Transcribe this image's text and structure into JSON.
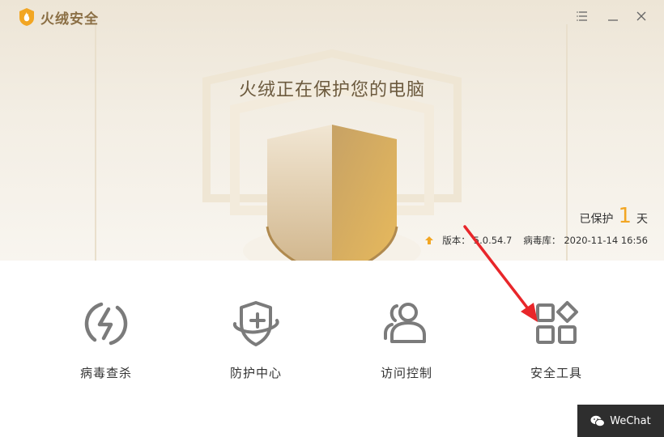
{
  "app": {
    "title": "火绒安全"
  },
  "window_controls": {
    "menu_icon": "menu-icon",
    "minimize_icon": "minimize-icon",
    "close_icon": "close-icon"
  },
  "status": {
    "headline": "火绒正在保护您的电脑",
    "protected_prefix": "已保护",
    "protected_days": "1",
    "protected_suffix": "天"
  },
  "version_info": {
    "version_label": "版本：",
    "version_value": "5.0.54.7",
    "db_label": "病毒库：",
    "db_value": "2020-11-14 16:56"
  },
  "tools": [
    {
      "label": "病毒查杀",
      "icon": "lightning-circle-icon"
    },
    {
      "label": "防护中心",
      "icon": "shield-plus-icon"
    },
    {
      "label": "访问控制",
      "icon": "users-icon"
    },
    {
      "label": "安全工具",
      "icon": "apps-grid-icon"
    }
  ],
  "watermark": {
    "label": "WeChat"
  },
  "colors": {
    "accent": "#f2a623",
    "brand": "#8b6f45",
    "icon_gray": "#7b7b7b",
    "annotation_arrow": "#e8262a"
  }
}
